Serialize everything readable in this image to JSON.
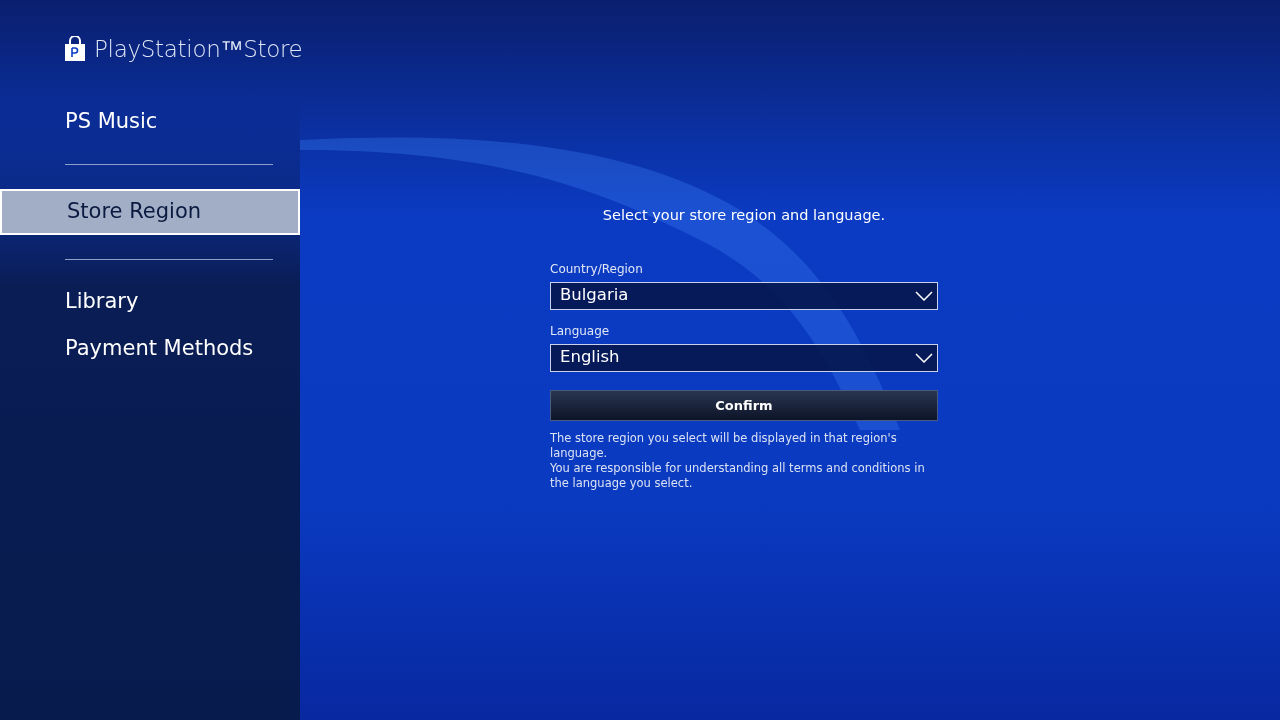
{
  "header": {
    "title": "PlayStation™Store"
  },
  "sidebar": {
    "groups": [
      {
        "items": [
          {
            "label": "PS Music",
            "selected": false
          }
        ]
      },
      {
        "items": [
          {
            "label": "Store Region",
            "selected": true
          }
        ]
      },
      {
        "items": [
          {
            "label": "Library",
            "selected": false
          },
          {
            "label": "Payment Methods",
            "selected": false
          }
        ]
      }
    ]
  },
  "form": {
    "heading": "Select your store region and language.",
    "fields": [
      {
        "label": "Country/Region",
        "value": "Bulgaria"
      },
      {
        "label": "Language",
        "value": "English"
      }
    ],
    "confirm_button": "Confirm",
    "notes": [
      "The store region you select will be displayed in that region's language.",
      "You are responsible for understanding all terms and conditions in the language you select."
    ]
  }
}
